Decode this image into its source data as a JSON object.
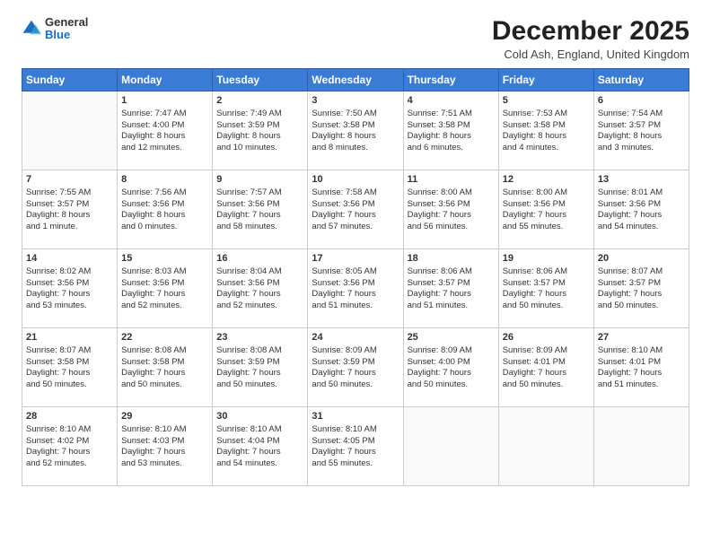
{
  "logo": {
    "general": "General",
    "blue": "Blue"
  },
  "header": {
    "title": "December 2025",
    "subtitle": "Cold Ash, England, United Kingdom"
  },
  "weekdays": [
    "Sunday",
    "Monday",
    "Tuesday",
    "Wednesday",
    "Thursday",
    "Friday",
    "Saturday"
  ],
  "weeks": [
    [
      {
        "day": "",
        "info": ""
      },
      {
        "day": "1",
        "info": "Sunrise: 7:47 AM\nSunset: 4:00 PM\nDaylight: 8 hours\nand 12 minutes."
      },
      {
        "day": "2",
        "info": "Sunrise: 7:49 AM\nSunset: 3:59 PM\nDaylight: 8 hours\nand 10 minutes."
      },
      {
        "day": "3",
        "info": "Sunrise: 7:50 AM\nSunset: 3:58 PM\nDaylight: 8 hours\nand 8 minutes."
      },
      {
        "day": "4",
        "info": "Sunrise: 7:51 AM\nSunset: 3:58 PM\nDaylight: 8 hours\nand 6 minutes."
      },
      {
        "day": "5",
        "info": "Sunrise: 7:53 AM\nSunset: 3:58 PM\nDaylight: 8 hours\nand 4 minutes."
      },
      {
        "day": "6",
        "info": "Sunrise: 7:54 AM\nSunset: 3:57 PM\nDaylight: 8 hours\nand 3 minutes."
      }
    ],
    [
      {
        "day": "7",
        "info": "Sunrise: 7:55 AM\nSunset: 3:57 PM\nDaylight: 8 hours\nand 1 minute."
      },
      {
        "day": "8",
        "info": "Sunrise: 7:56 AM\nSunset: 3:56 PM\nDaylight: 8 hours\nand 0 minutes."
      },
      {
        "day": "9",
        "info": "Sunrise: 7:57 AM\nSunset: 3:56 PM\nDaylight: 7 hours\nand 58 minutes."
      },
      {
        "day": "10",
        "info": "Sunrise: 7:58 AM\nSunset: 3:56 PM\nDaylight: 7 hours\nand 57 minutes."
      },
      {
        "day": "11",
        "info": "Sunrise: 8:00 AM\nSunset: 3:56 PM\nDaylight: 7 hours\nand 56 minutes."
      },
      {
        "day": "12",
        "info": "Sunrise: 8:00 AM\nSunset: 3:56 PM\nDaylight: 7 hours\nand 55 minutes."
      },
      {
        "day": "13",
        "info": "Sunrise: 8:01 AM\nSunset: 3:56 PM\nDaylight: 7 hours\nand 54 minutes."
      }
    ],
    [
      {
        "day": "14",
        "info": "Sunrise: 8:02 AM\nSunset: 3:56 PM\nDaylight: 7 hours\nand 53 minutes."
      },
      {
        "day": "15",
        "info": "Sunrise: 8:03 AM\nSunset: 3:56 PM\nDaylight: 7 hours\nand 52 minutes."
      },
      {
        "day": "16",
        "info": "Sunrise: 8:04 AM\nSunset: 3:56 PM\nDaylight: 7 hours\nand 52 minutes."
      },
      {
        "day": "17",
        "info": "Sunrise: 8:05 AM\nSunset: 3:56 PM\nDaylight: 7 hours\nand 51 minutes."
      },
      {
        "day": "18",
        "info": "Sunrise: 8:06 AM\nSunset: 3:57 PM\nDaylight: 7 hours\nand 51 minutes."
      },
      {
        "day": "19",
        "info": "Sunrise: 8:06 AM\nSunset: 3:57 PM\nDaylight: 7 hours\nand 50 minutes."
      },
      {
        "day": "20",
        "info": "Sunrise: 8:07 AM\nSunset: 3:57 PM\nDaylight: 7 hours\nand 50 minutes."
      }
    ],
    [
      {
        "day": "21",
        "info": "Sunrise: 8:07 AM\nSunset: 3:58 PM\nDaylight: 7 hours\nand 50 minutes."
      },
      {
        "day": "22",
        "info": "Sunrise: 8:08 AM\nSunset: 3:58 PM\nDaylight: 7 hours\nand 50 minutes."
      },
      {
        "day": "23",
        "info": "Sunrise: 8:08 AM\nSunset: 3:59 PM\nDaylight: 7 hours\nand 50 minutes."
      },
      {
        "day": "24",
        "info": "Sunrise: 8:09 AM\nSunset: 3:59 PM\nDaylight: 7 hours\nand 50 minutes."
      },
      {
        "day": "25",
        "info": "Sunrise: 8:09 AM\nSunset: 4:00 PM\nDaylight: 7 hours\nand 50 minutes."
      },
      {
        "day": "26",
        "info": "Sunrise: 8:09 AM\nSunset: 4:01 PM\nDaylight: 7 hours\nand 50 minutes."
      },
      {
        "day": "27",
        "info": "Sunrise: 8:10 AM\nSunset: 4:01 PM\nDaylight: 7 hours\nand 51 minutes."
      }
    ],
    [
      {
        "day": "28",
        "info": "Sunrise: 8:10 AM\nSunset: 4:02 PM\nDaylight: 7 hours\nand 52 minutes."
      },
      {
        "day": "29",
        "info": "Sunrise: 8:10 AM\nSunset: 4:03 PM\nDaylight: 7 hours\nand 53 minutes."
      },
      {
        "day": "30",
        "info": "Sunrise: 8:10 AM\nSunset: 4:04 PM\nDaylight: 7 hours\nand 54 minutes."
      },
      {
        "day": "31",
        "info": "Sunrise: 8:10 AM\nSunset: 4:05 PM\nDaylight: 7 hours\nand 55 minutes."
      },
      {
        "day": "",
        "info": ""
      },
      {
        "day": "",
        "info": ""
      },
      {
        "day": "",
        "info": ""
      }
    ]
  ]
}
